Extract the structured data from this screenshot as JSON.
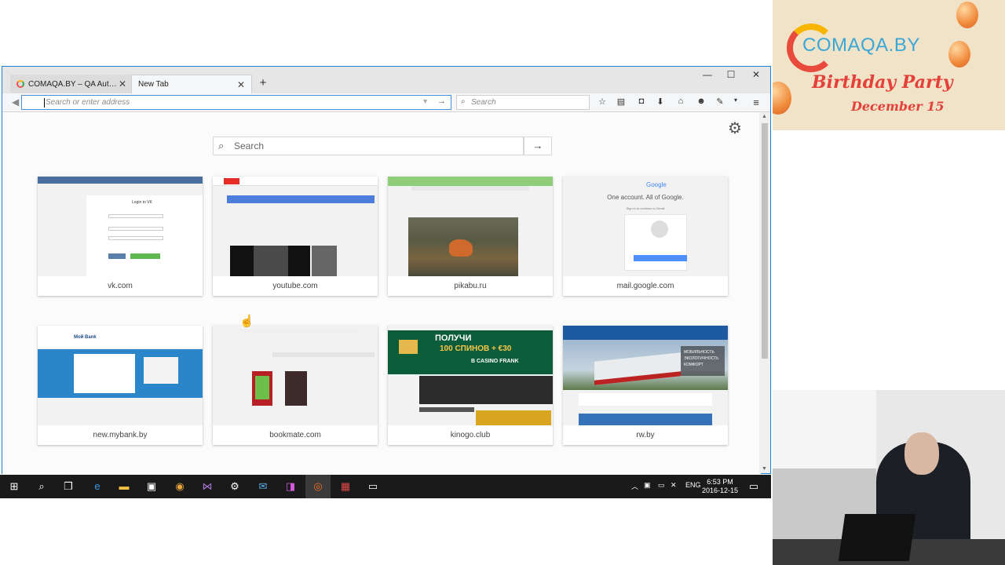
{
  "browser": {
    "tabs": [
      {
        "label": "COMAQA.BY – QA Autom..."
      },
      {
        "label": "New Tab"
      }
    ],
    "new_tab_symbol": "+",
    "window_controls": {
      "minimize": "—",
      "maximize": "☐",
      "close": "✕"
    },
    "address_placeholder": "Search or enter address",
    "search_placeholder": "Search"
  },
  "newtab": {
    "search_placeholder": "Search",
    "tiles": [
      {
        "site": "vk.com"
      },
      {
        "site": "youtube.com"
      },
      {
        "site": "pikabu.ru"
      },
      {
        "site": "mail.google.com"
      },
      {
        "site": "new.mybank.by"
      },
      {
        "site": "bookmate.com"
      },
      {
        "site": "kinogo.club"
      },
      {
        "site": "rw.by"
      }
    ],
    "thumb_text": {
      "vk_login": "Login to VK",
      "google_logo": "Google",
      "google_tagline": "One account. All of Google.",
      "google_sub": "Sign in to continue to Gmail",
      "mybank_logo": "Moй Bank",
      "kinogo_line1": "ПОЛУЧИ",
      "kinogo_line2": "100 СПИНОВ + €30",
      "kinogo_line3": "В CASINO FRANK",
      "rw_sign": "МОБИЛЬНОСТЬ ЭКОЛОГИЧНОСТЬ КОМФОРТ"
    }
  },
  "taskbar": {
    "language": "ENG",
    "time": "6:53 PM",
    "date": "2016-12-15"
  },
  "banner": {
    "logo": "COMAQA.BY",
    "title": "Birthday Party",
    "date": "December 15"
  },
  "icons": {
    "tab_close": "close-icon",
    "back": "back-arrow-icon",
    "bookmark": "star-icon",
    "reading_list": "clipboard-icon",
    "pocket": "pocket-icon",
    "downloads": "download-icon",
    "home": "home-icon",
    "emoji": "smiley-icon",
    "menu": "hamburger-icon",
    "settings": "gear-icon"
  },
  "colors": {
    "accent": "#1e7fd6",
    "banner_red": "#e5403a",
    "banner_blue": "#3aa7d8",
    "taskbar": "#1a1a1a"
  }
}
